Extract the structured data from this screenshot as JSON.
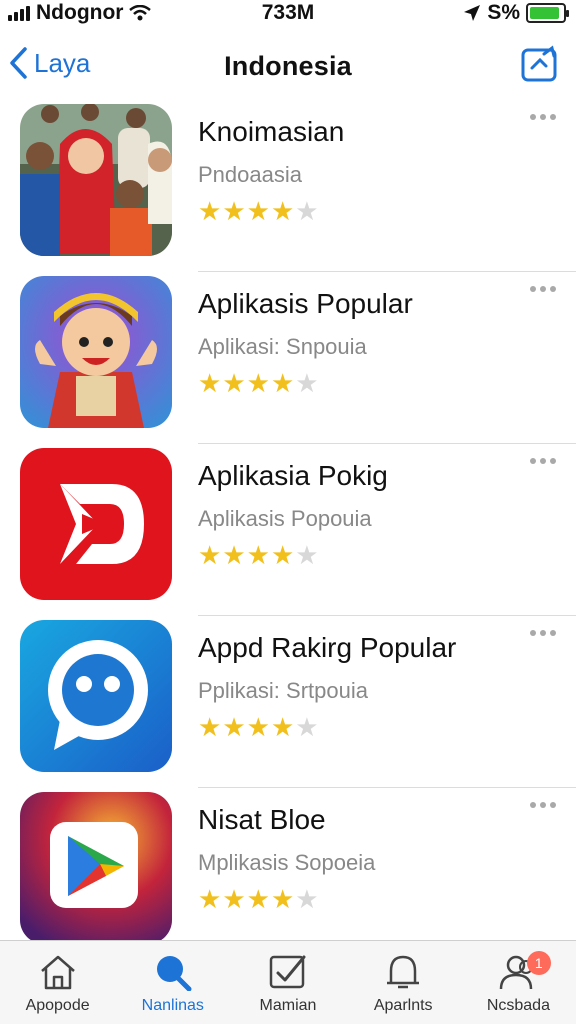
{
  "status_bar": {
    "carrier": "Ndognor",
    "time": "733M",
    "right_text": "S%",
    "battery_level": 0.9
  },
  "nav": {
    "back_label": "Laya",
    "title": "Indonesia"
  },
  "apps": [
    {
      "name": "Knoimasian",
      "subtitle": "Pndoaasia",
      "rating": 4,
      "icon": "people-photo-icon"
    },
    {
      "name": "Aplikasis Popular",
      "subtitle": "Aplikasi: Snpouia",
      "rating": 4,
      "icon": "cartoon-boy-icon"
    },
    {
      "name": "Aplikasia Pokig",
      "subtitle": "Aplikasis Popouia",
      "rating": 4,
      "icon": "red-play-icon"
    },
    {
      "name": "Appd Rakirg Popular",
      "subtitle": "Pplikasi: Srtpouia",
      "rating": 4,
      "icon": "chat-bubble-icon"
    },
    {
      "name": "Nisat Bloe",
      "subtitle": "Mplikasis Sopoeia",
      "rating": 4,
      "icon": "play-store-icon"
    }
  ],
  "tabs": [
    {
      "label": "Apopode",
      "icon": "home-icon",
      "active": false
    },
    {
      "label": "Nanlinas",
      "icon": "search-icon",
      "active": true
    },
    {
      "label": "Mamian",
      "icon": "checkbox-icon",
      "active": false
    },
    {
      "label": "Aparlnts",
      "icon": "bell-icon",
      "active": false
    },
    {
      "label": "Ncsbada",
      "icon": "people-icon",
      "active": false,
      "badge": "1"
    }
  ],
  "colors": {
    "accent": "#1d73d6",
    "star": "#f2c01d",
    "battery": "#35c234",
    "badge": "#ff6b5a"
  }
}
